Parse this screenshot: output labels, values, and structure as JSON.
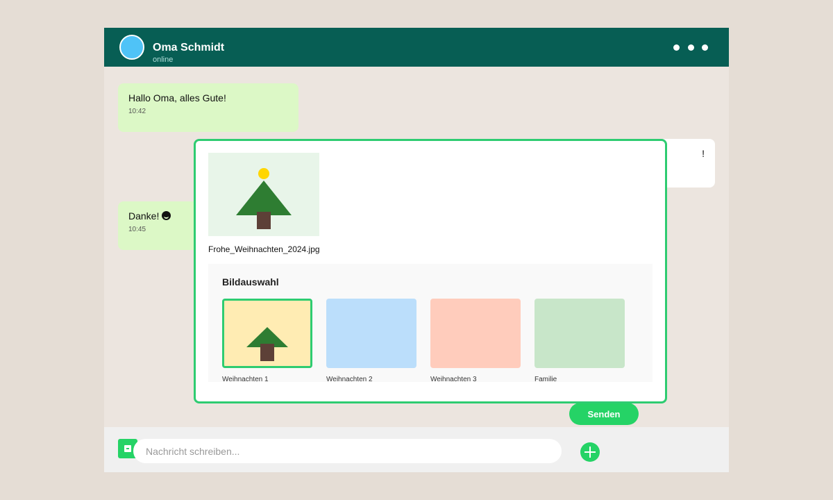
{
  "header": {
    "contact_name": "Oma Schmidt",
    "status": "online",
    "avatar_color": "#4fc3f7",
    "menu_icon": "more-horizontal-icon"
  },
  "messages": [
    {
      "direction": "incoming",
      "text": "Hallo Oma, alles Gute!",
      "time": "10:42"
    },
    {
      "direction": "outgoing",
      "text": "!",
      "time": ""
    },
    {
      "direction": "incoming",
      "text": "Danke!",
      "emoji": "smile-emoji",
      "time": "10:45"
    }
  ],
  "attachment_preview": {
    "filename": "Frohe_Weihnachten_2024.jpg",
    "thumbnail_icon": "christmas-tree-icon"
  },
  "image_picker": {
    "title": "Bildauswahl",
    "selected_index": 0,
    "items": [
      {
        "label": "Weihnachten 1",
        "color": "#ffecb3",
        "icon": "christmas-tree-icon"
      },
      {
        "label": "Weihnachten 2",
        "color": "#bbdefb"
      },
      {
        "label": "Weihnachten 3",
        "color": "#ffccbc"
      },
      {
        "label": "Familie",
        "color": "#c8e6c9"
      }
    ]
  },
  "composer": {
    "placeholder": "Nachricht schreiben...",
    "value": "",
    "attach_icon": "attachment-icon",
    "add_icon": "plus-icon"
  },
  "send_button": {
    "label": "Senden"
  },
  "colors": {
    "header": "#075e54",
    "accent": "#25d366",
    "incoming_bubble": "#dcf8c6",
    "outgoing_bubble": "#ffffff",
    "selection_border": "#2ecc71"
  }
}
